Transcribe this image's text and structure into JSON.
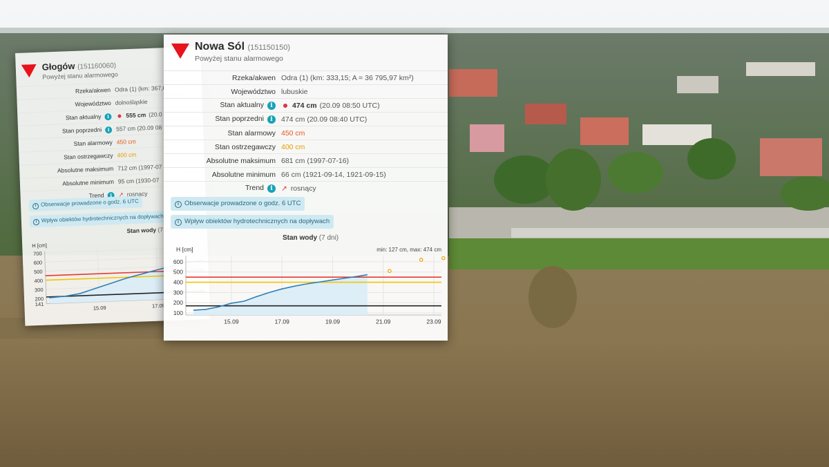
{
  "accent_colors": {
    "alarm_line": "#e53935",
    "warning_line": "#f2c500",
    "min_line": "#222222",
    "series_line": "#2e7fb8",
    "series_fill": "#d9ecf7",
    "info": "#17a2b8",
    "badge_bg": "#cfe9f2"
  },
  "back_card": {
    "station_name": "Głogów",
    "station_id": "(151160060)",
    "status": "Powyżej stanu alarmowego",
    "rows": [
      {
        "label": "Rzeka/akwen",
        "value": "Odra (1) (km: 367,6",
        "info": false
      },
      {
        "label": "Województwo",
        "value": "dolnośląskie",
        "info": false
      },
      {
        "label": "Stan aktualny",
        "value": "555 cm",
        "value_extra": "(20.0",
        "info": true
      },
      {
        "label": "Stan poprzedni",
        "value": "557 cm (20.09 08",
        "info": true
      },
      {
        "label": "Stan alarmowy",
        "value": "450 cm",
        "info": false
      },
      {
        "label": "Stan ostrzegawczy",
        "value": "400 cm",
        "info": false
      },
      {
        "label": "Absolutne maksimum",
        "value": "712 cm (1997-07",
        "info": false
      },
      {
        "label": "Absolutne minimum",
        "value": "95 cm (1930-07",
        "info": false
      },
      {
        "label": "Trend",
        "value": "rosnący",
        "info": true
      }
    ],
    "badges": [
      "Obserwacje prowadzone o godz. 6 UTC",
      "Wpływ obiektów hydrotechnicznych na dopływach"
    ],
    "chart_caption": "Stan wody",
    "chart_caption_extra": "(7 dni"
  },
  "front_card": {
    "station_name": "Nowa Sól",
    "station_id": "(151150150)",
    "status": "Powyżej stanu alarmowego",
    "rows": [
      {
        "label": "Rzeka/akwen",
        "value": "Odra (1) (km: 333,15; A = 36 795,97 km²)",
        "info": false
      },
      {
        "label": "Województwo",
        "value": "lubuskie",
        "info": false
      },
      {
        "label": "Stan aktualny",
        "value": "474 cm",
        "value_extra": "(20.09 08:50 UTC)",
        "info": true
      },
      {
        "label": "Stan poprzedni",
        "value": "474 cm (20.09 08:40 UTC)",
        "info": true
      },
      {
        "label": "Stan alarmowy",
        "value": "450 cm",
        "info": false
      },
      {
        "label": "Stan ostrzegawczy",
        "value": "400 cm",
        "info": false
      },
      {
        "label": "Absolutne maksimum",
        "value": "681 cm (1997-07-16)",
        "info": false
      },
      {
        "label": "Absolutne minimum",
        "value": "66 cm (1921-09-14, 1921-09-15)",
        "info": false
      },
      {
        "label": "Trend",
        "value": "rosnący",
        "info": true
      }
    ],
    "badges": [
      "Obserwacje prowadzone o godz. 6 UTC",
      "Wpływ obiektów hydrotechnicznych na dopływach"
    ],
    "chart_caption": "Stan wody",
    "chart_caption_extra": "(7 dni)",
    "chart_minmax": "min: 127 cm, max: 474 cm",
    "chart_ylabel": "H [cm]"
  },
  "chart_data": [
    {
      "type": "line",
      "title": "Stan wody (7 dni)",
      "ylabel": "H [cm]",
      "xlabel": "",
      "x_ticks": [
        "15.09",
        "17.09",
        "19.09",
        "21.09",
        "23.09"
      ],
      "y_ticks": [
        100,
        200,
        300,
        400,
        500,
        600
      ],
      "ylim": [
        80,
        660
      ],
      "x": [
        "13.09 12:00",
        "14.09 00:00",
        "14.09 12:00",
        "15.09 00:00",
        "15.09 12:00",
        "16.09 00:00",
        "16.09 12:00",
        "17.09 00:00",
        "17.09 12:00",
        "18.09 00:00",
        "18.09 12:00",
        "19.09 00:00",
        "19.09 12:00",
        "20.09 00:00",
        "20.09 09:00"
      ],
      "series": [
        {
          "values": [
            127,
            135,
            160,
            195,
            215,
            260,
            300,
            335,
            362,
            385,
            403,
            422,
            440,
            458,
            474
          ]
        }
      ],
      "reference_lines": {
        "alarm": 450,
        "warning": 400,
        "minimum": 170
      },
      "forecast_points": [
        {
          "x": "21.09 06:00",
          "y": 510
        },
        {
          "x": "22.09 12:00",
          "y": 620
        },
        {
          "x": "23.09 09:00",
          "y": 635
        }
      ],
      "grid": true
    },
    {
      "type": "line",
      "title": "Stan wody (7 dni",
      "ylabel": "H [cm]",
      "x_ticks": [
        "15.09",
        "17.09"
      ],
      "y_ticks": [
        141,
        200,
        300,
        400,
        500,
        600,
        700
      ],
      "ylim": [
        141,
        720
      ],
      "series": [
        {
          "values": [
            205,
            215,
            240,
            290,
            340,
            390,
            430,
            470,
            505,
            540,
            560
          ]
        }
      ],
      "reference_lines": {
        "alarm": 450,
        "warning": 400,
        "minimum": 215
      },
      "grid": true
    }
  ]
}
